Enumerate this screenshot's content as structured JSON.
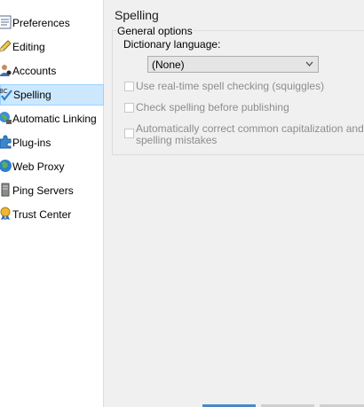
{
  "sidebar": {
    "items": [
      {
        "label": "Preferences",
        "icon": "preferences-icon"
      },
      {
        "label": "Editing",
        "icon": "pencil-icon"
      },
      {
        "label": "Accounts",
        "icon": "accounts-icon"
      },
      {
        "label": "Spelling",
        "icon": "spelling-icon",
        "selected": true
      },
      {
        "label": "Automatic Linking",
        "icon": "globe-link-icon"
      },
      {
        "label": "Plug-ins",
        "icon": "puzzle-icon"
      },
      {
        "label": "Web Proxy",
        "icon": "globe-icon"
      },
      {
        "label": "Ping Servers",
        "icon": "server-icon"
      },
      {
        "label": "Trust Center",
        "icon": "award-icon"
      }
    ]
  },
  "main": {
    "title": "Spelling",
    "group_title": "General options",
    "dictionary_label": "Dictionary language:",
    "dictionary_value": "(None)",
    "options": [
      {
        "label": "Use real-time spell checking (squiggles)",
        "checked": false,
        "enabled": false
      },
      {
        "label": "Check spelling before publishing",
        "checked": false,
        "enabled": false
      },
      {
        "label_line1": "Automatically correct common capitalization and",
        "label_line2": "spelling mistakes",
        "checked": false,
        "enabled": false
      }
    ]
  },
  "colors": {
    "selection_bg": "#cce8ff",
    "selection_border": "#99d1ff",
    "disabled_text": "#8d8d8d"
  }
}
